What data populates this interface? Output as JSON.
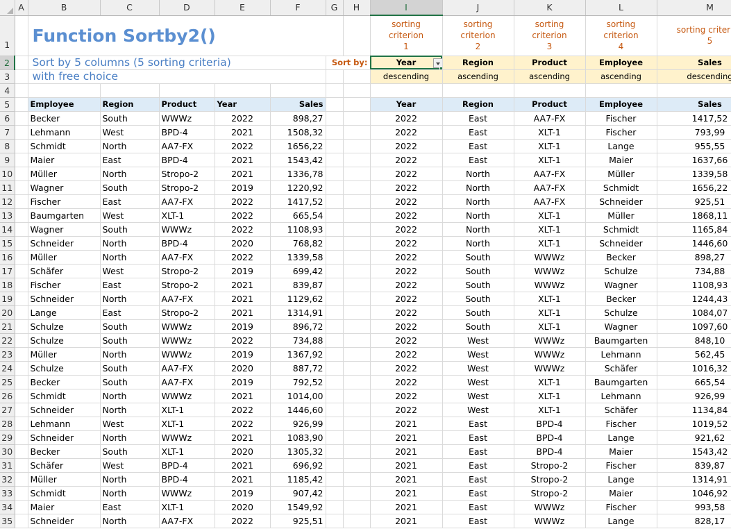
{
  "columns": [
    "A",
    "B",
    "C",
    "D",
    "E",
    "F",
    "G",
    "H",
    "I",
    "J",
    "K",
    "L",
    "M"
  ],
  "selected_column": "I",
  "selected_row": "2",
  "title": "Function Sortby2()",
  "subtitle1": "Sort by 5 columns (5 sorting criteria)",
  "subtitle2": "with free choice",
  "sort_by_label": "Sort by:",
  "criteria": [
    {
      "label": "sorting criterion",
      "num": "1",
      "field": "Year",
      "order": "descending"
    },
    {
      "label": "sorting criterion",
      "num": "2",
      "field": "Region",
      "order": "ascending"
    },
    {
      "label": "sorting criterion",
      "num": "3",
      "field": "Product",
      "order": "ascending"
    },
    {
      "label": "sorting criterion",
      "num": "4",
      "field": "Employee",
      "order": "ascending"
    },
    {
      "label": "sorting criterion",
      "num": "5",
      "field": "Sales",
      "order": "descending"
    }
  ],
  "source_headers": [
    "Employee",
    "Region",
    "Product",
    "Year",
    "Sales"
  ],
  "result_headers": [
    "Year",
    "Region",
    "Product",
    "Employee",
    "Sales"
  ],
  "source_rows": [
    [
      "Becker",
      "South",
      "WWWz",
      "2022",
      "898,27"
    ],
    [
      "Lehmann",
      "West",
      "BPD-4",
      "2021",
      "1508,32"
    ],
    [
      "Schmidt",
      "North",
      "AA7-FX",
      "2022",
      "1656,22"
    ],
    [
      "Maier",
      "East",
      "BPD-4",
      "2021",
      "1543,42"
    ],
    [
      "Müller",
      "North",
      "Stropo-2",
      "2021",
      "1336,78"
    ],
    [
      "Wagner",
      "South",
      "Stropo-2",
      "2019",
      "1220,92"
    ],
    [
      "Fischer",
      "East",
      "AA7-FX",
      "2022",
      "1417,52"
    ],
    [
      "Baumgarten",
      "West",
      "XLT-1",
      "2022",
      "665,54"
    ],
    [
      "Wagner",
      "South",
      "WWWz",
      "2022",
      "1108,93"
    ],
    [
      "Schneider",
      "North",
      "BPD-4",
      "2020",
      "768,82"
    ],
    [
      "Müller",
      "North",
      "AA7-FX",
      "2022",
      "1339,58"
    ],
    [
      "Schäfer",
      "West",
      "Stropo-2",
      "2019",
      "699,42"
    ],
    [
      "Fischer",
      "East",
      "Stropo-2",
      "2021",
      "839,87"
    ],
    [
      "Schneider",
      "North",
      "AA7-FX",
      "2021",
      "1129,62"
    ],
    [
      "Lange",
      "East",
      "Stropo-2",
      "2021",
      "1314,91"
    ],
    [
      "Schulze",
      "South",
      "WWWz",
      "2019",
      "896,72"
    ],
    [
      "Schulze",
      "South",
      "WWWz",
      "2022",
      "734,88"
    ],
    [
      "Müller",
      "North",
      "WWWz",
      "2019",
      "1367,92"
    ],
    [
      "Schulze",
      "South",
      "AA7-FX",
      "2020",
      "887,72"
    ],
    [
      "Becker",
      "South",
      "AA7-FX",
      "2019",
      "792,52"
    ],
    [
      "Schmidt",
      "North",
      "WWWz",
      "2021",
      "1014,00"
    ],
    [
      "Schneider",
      "North",
      "XLT-1",
      "2022",
      "1446,60"
    ],
    [
      "Lehmann",
      "West",
      "XLT-1",
      "2022",
      "926,99"
    ],
    [
      "Schneider",
      "North",
      "WWWz",
      "2021",
      "1083,90"
    ],
    [
      "Becker",
      "South",
      "XLT-1",
      "2020",
      "1305,32"
    ],
    [
      "Schäfer",
      "West",
      "BPD-4",
      "2021",
      "696,92"
    ],
    [
      "Müller",
      "North",
      "BPD-4",
      "2021",
      "1185,42"
    ],
    [
      "Schmidt",
      "North",
      "WWWz",
      "2019",
      "907,42"
    ],
    [
      "Maier",
      "East",
      "XLT-1",
      "2020",
      "1549,92"
    ],
    [
      "Schneider",
      "North",
      "AA7-FX",
      "2022",
      "925,51"
    ]
  ],
  "result_rows": [
    [
      "2022",
      "East",
      "AA7-FX",
      "Fischer",
      "1417,52"
    ],
    [
      "2022",
      "East",
      "XLT-1",
      "Fischer",
      "793,99"
    ],
    [
      "2022",
      "East",
      "XLT-1",
      "Lange",
      "955,55"
    ],
    [
      "2022",
      "East",
      "XLT-1",
      "Maier",
      "1637,66"
    ],
    [
      "2022",
      "North",
      "AA7-FX",
      "Müller",
      "1339,58"
    ],
    [
      "2022",
      "North",
      "AA7-FX",
      "Schmidt",
      "1656,22"
    ],
    [
      "2022",
      "North",
      "AA7-FX",
      "Schneider",
      "925,51"
    ],
    [
      "2022",
      "North",
      "XLT-1",
      "Müller",
      "1868,11"
    ],
    [
      "2022",
      "North",
      "XLT-1",
      "Schmidt",
      "1165,84"
    ],
    [
      "2022",
      "North",
      "XLT-1",
      "Schneider",
      "1446,60"
    ],
    [
      "2022",
      "South",
      "WWWz",
      "Becker",
      "898,27"
    ],
    [
      "2022",
      "South",
      "WWWz",
      "Schulze",
      "734,88"
    ],
    [
      "2022",
      "South",
      "WWWz",
      "Wagner",
      "1108,93"
    ],
    [
      "2022",
      "South",
      "XLT-1",
      "Becker",
      "1244,43"
    ],
    [
      "2022",
      "South",
      "XLT-1",
      "Schulze",
      "1084,07"
    ],
    [
      "2022",
      "South",
      "XLT-1",
      "Wagner",
      "1097,60"
    ],
    [
      "2022",
      "West",
      "WWWz",
      "Baumgarten",
      "848,10"
    ],
    [
      "2022",
      "West",
      "WWWz",
      "Lehmann",
      "562,45"
    ],
    [
      "2022",
      "West",
      "WWWz",
      "Schäfer",
      "1016,32"
    ],
    [
      "2022",
      "West",
      "XLT-1",
      "Baumgarten",
      "665,54"
    ],
    [
      "2022",
      "West",
      "XLT-1",
      "Lehmann",
      "926,99"
    ],
    [
      "2022",
      "West",
      "XLT-1",
      "Schäfer",
      "1134,84"
    ],
    [
      "2021",
      "East",
      "BPD-4",
      "Fischer",
      "1019,52"
    ],
    [
      "2021",
      "East",
      "BPD-4",
      "Lange",
      "921,62"
    ],
    [
      "2021",
      "East",
      "BPD-4",
      "Maier",
      "1543,42"
    ],
    [
      "2021",
      "East",
      "Stropo-2",
      "Fischer",
      "839,87"
    ],
    [
      "2021",
      "East",
      "Stropo-2",
      "Lange",
      "1314,91"
    ],
    [
      "2021",
      "East",
      "Stropo-2",
      "Maier",
      "1046,92"
    ],
    [
      "2021",
      "East",
      "WWWz",
      "Fischer",
      "993,58"
    ],
    [
      "2021",
      "East",
      "WWWz",
      "Lange",
      "828,17"
    ]
  ]
}
